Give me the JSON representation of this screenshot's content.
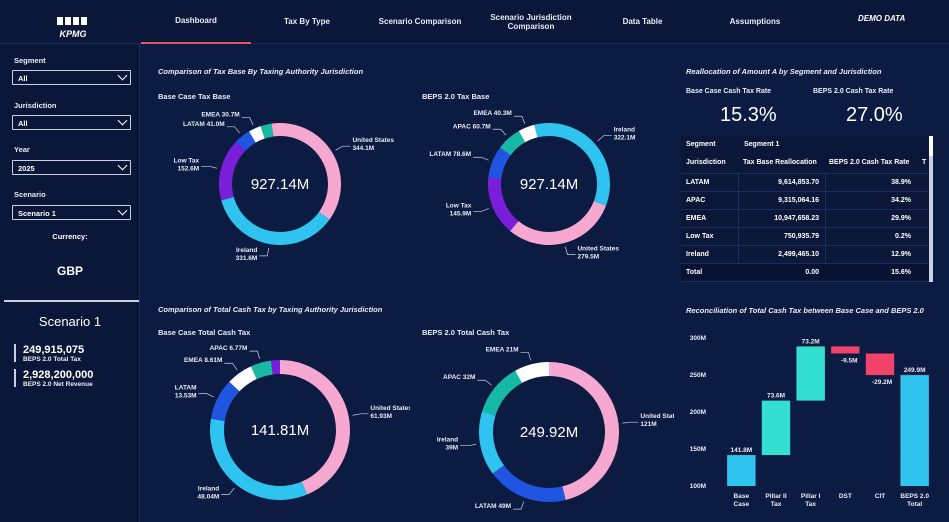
{
  "nav": {
    "logo": "KPMG",
    "tabs": [
      "Dashboard",
      "Tax By Type",
      "Scenario Comparison",
      "Scenario Jurisdiction Comparison",
      "Data Table",
      "Assumptions"
    ],
    "active_tab": "Dashboard",
    "demo_label": "DEMO DATA"
  },
  "sidebar": {
    "segment_label": "Segment",
    "segment_value": "All",
    "jurisdiction_label": "Jurisdiction",
    "jurisdiction_value": "All",
    "year_label": "Year",
    "year_value": "2025",
    "scenario_label": "Scenario",
    "scenario_value": "Scenario 1",
    "currency_label": "Currency:",
    "currency_value": "GBP",
    "scenario_title": "Scenario 1",
    "stat1_value": "249,915,075",
    "stat1_label": "BEPS 2.0 Total Tax",
    "stat2_value": "2,928,200,000",
    "stat2_label": "BEPS 2.0 Net Revenue"
  },
  "sections": {
    "tax_base_title": "Comparison of Tax Base By Taxing Authority Jurisdiction",
    "cash_tax_title": "Comparison of Total Cash Tax by Taxing Authority Jurisdiction",
    "realloc_title": "Reallocation of Amount A by Segment and Jurisdiction",
    "recon_title": "Reconciliation of Total Cash Tax between Base Case and BEPS 2.0"
  },
  "kpis": {
    "base_rate_label": "Base Case Cash Tax Rate",
    "base_rate_value": "15.3%",
    "beps_rate_label": "BEPS 2.0 Cash Tax Rate",
    "beps_rate_value": "27.0%"
  },
  "table": {
    "segment_label": "Segment",
    "segment_value": "Segment 1",
    "headers": [
      "Jurisdiction",
      "Tax Base Reallocation",
      "BEPS 2.0 Cash Tax Rate",
      "T"
    ],
    "rows": [
      [
        "LATAM",
        "9,614,853.70",
        "38.9%"
      ],
      [
        "APAC",
        "9,315,064.16",
        "34.2%"
      ],
      [
        "EMEA",
        "10,947,658.23",
        "29.9%"
      ],
      [
        "Low Tax",
        "750,935.79",
        "0.2%"
      ],
      [
        "Ireland",
        "2,499,465.10",
        "12.9%"
      ],
      [
        "Total",
        "0.00",
        "15.6%"
      ]
    ]
  },
  "chart_data": [
    {
      "type": "pie",
      "title": "Base Case Tax Base",
      "center_label": "927.14M",
      "slices": [
        {
          "name": "United States",
          "value": 344.1,
          "label": "United States 344.1M",
          "color": "#f7a8d0"
        },
        {
          "name": "Ireland",
          "value": 331.6,
          "label": "Ireland 331.6M",
          "color": "#2fc3ef"
        },
        {
          "name": "Low Tax",
          "value": 152.6,
          "label": "Low Tax 152.6M",
          "color": "#7a1fd9"
        },
        {
          "name": "LATAM",
          "value": 41.0,
          "label": "LATAM 41.0M",
          "color": "#1f55e0"
        },
        {
          "name": "EMEA",
          "value": 30.7,
          "label": "EMEA 30.7M",
          "color": "#ffffff"
        },
        {
          "name": "APAC",
          "value": 27.1,
          "label": "",
          "color": "#18b8a6"
        }
      ]
    },
    {
      "type": "pie",
      "title": "BEPS 2.0 Tax Base",
      "center_label": "927.14M",
      "slices": [
        {
          "name": "Ireland",
          "value": 322.1,
          "label": "Ireland 322.1M",
          "color": "#2fc3ef"
        },
        {
          "name": "United States",
          "value": 279.5,
          "label": "United States 279.5M",
          "color": "#f7a8d0"
        },
        {
          "name": "Low Tax",
          "value": 145.9,
          "label": "Low Tax 145.9M",
          "color": "#7a1fd9"
        },
        {
          "name": "LATAM",
          "value": 78.6,
          "label": "LATAM 78.6M",
          "color": "#1f55e0"
        },
        {
          "name": "APAC",
          "value": 60.7,
          "label": "APAC 60.7M",
          "color": "#18b8a6"
        },
        {
          "name": "EMEA",
          "value": 40.3,
          "label": "EMEA 40.3M",
          "color": "#ffffff"
        }
      ]
    },
    {
      "type": "pie",
      "title": "Base Case Total Cash Tax",
      "center_label": "141.81M",
      "slices": [
        {
          "name": "United States",
          "value": 61.93,
          "label": "United States 61.93M",
          "color": "#f7a8d0"
        },
        {
          "name": "Ireland",
          "value": 48.04,
          "label": "Ireland 48.04M",
          "color": "#2fc3ef"
        },
        {
          "name": "LATAM",
          "value": 13.53,
          "label": "LATAM 13.53M",
          "color": "#1f55e0"
        },
        {
          "name": "EMEA",
          "value": 8.61,
          "label": "EMEA 8.61M",
          "color": "#ffffff"
        },
        {
          "name": "APAC",
          "value": 6.77,
          "label": "APAC 6.77M",
          "color": "#18b8a6"
        },
        {
          "name": "Low Tax",
          "value": 2.9,
          "label": "",
          "color": "#7a1fd9"
        }
      ]
    },
    {
      "type": "pie",
      "title": "BEPS 2.0 Total Cash Tax",
      "center_label": "249.92M",
      "slices": [
        {
          "name": "United States",
          "value": 121,
          "label": "United States 121M",
          "color": "#f7a8d0"
        },
        {
          "name": "LATAM",
          "value": 49,
          "label": "LATAM 49M",
          "color": "#1f55e0"
        },
        {
          "name": "Ireland",
          "value": 39,
          "label": "Ireland 39M",
          "color": "#2fc3ef"
        },
        {
          "name": "APAC",
          "value": 32,
          "label": "APAC 32M",
          "color": "#18b8a6"
        },
        {
          "name": "EMEA",
          "value": 21,
          "label": "EMEA 21M",
          "color": "#ffffff"
        }
      ]
    },
    {
      "type": "bar",
      "subtype": "waterfall",
      "categories": [
        "Base Case",
        "Pillar II Tax",
        "Pillar I Tax",
        "DST",
        "CIT",
        "BEPS 2.0 Total"
      ],
      "values": [
        141.8,
        73.6,
        73.2,
        -9.5,
        -29.2,
        249.9
      ],
      "data_labels": [
        "141.8M",
        "73.6M",
        "73.2M",
        "-9.5M",
        "-29.2M",
        "249.9M"
      ],
      "kinds": [
        "total",
        "increase",
        "increase",
        "decrease",
        "decrease",
        "total"
      ],
      "colors": {
        "total": "#2fc3ef",
        "increase": "#33e0d0",
        "decrease": "#f0436a"
      },
      "yticks": [
        "100M",
        "150M",
        "200M",
        "250M",
        "300M"
      ],
      "ylim": [
        100,
        300
      ]
    }
  ]
}
